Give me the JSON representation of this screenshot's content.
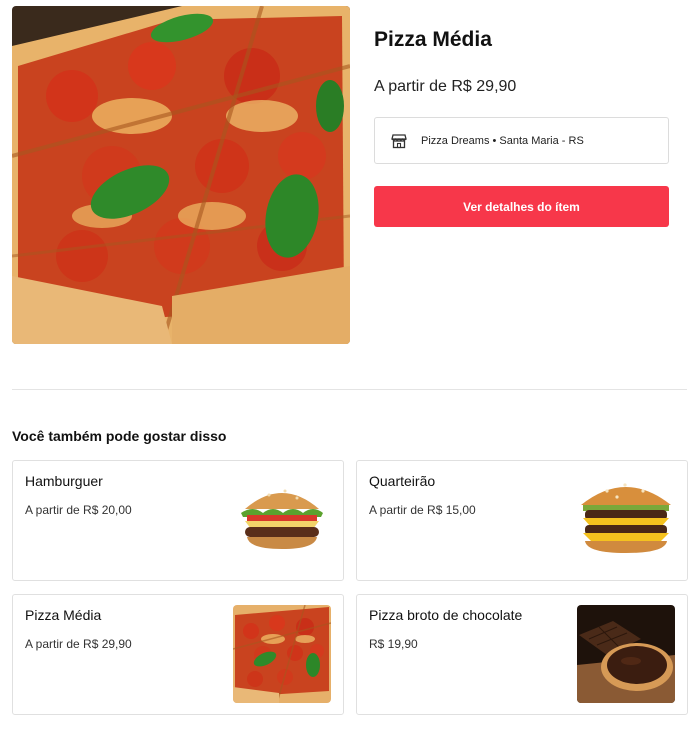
{
  "product": {
    "name": "Pizza Média",
    "price": "A partir de R$ 29,90",
    "image_icon": "pizza-photo"
  },
  "store": {
    "icon": "store-icon",
    "label": "Pizza Dreams • Santa Maria - RS"
  },
  "cta": {
    "label": "Ver detalhes do ítem",
    "color": "#f7374a"
  },
  "related": {
    "title": "Você também pode gostar disso",
    "items": [
      {
        "name": "Hamburguer",
        "price": "A partir de R$ 20,00",
        "image": "burger-photo"
      },
      {
        "name": "Quarteirão",
        "price": "A partir de R$ 15,00",
        "image": "cheeseburger-photo"
      },
      {
        "name": "Pizza Média",
        "price": "A partir de R$ 29,90",
        "image": "pizza-photo"
      },
      {
        "name": "Pizza broto de chocolate",
        "price": "R$ 19,90",
        "image": "chocolate-pizza-photo"
      }
    ]
  }
}
